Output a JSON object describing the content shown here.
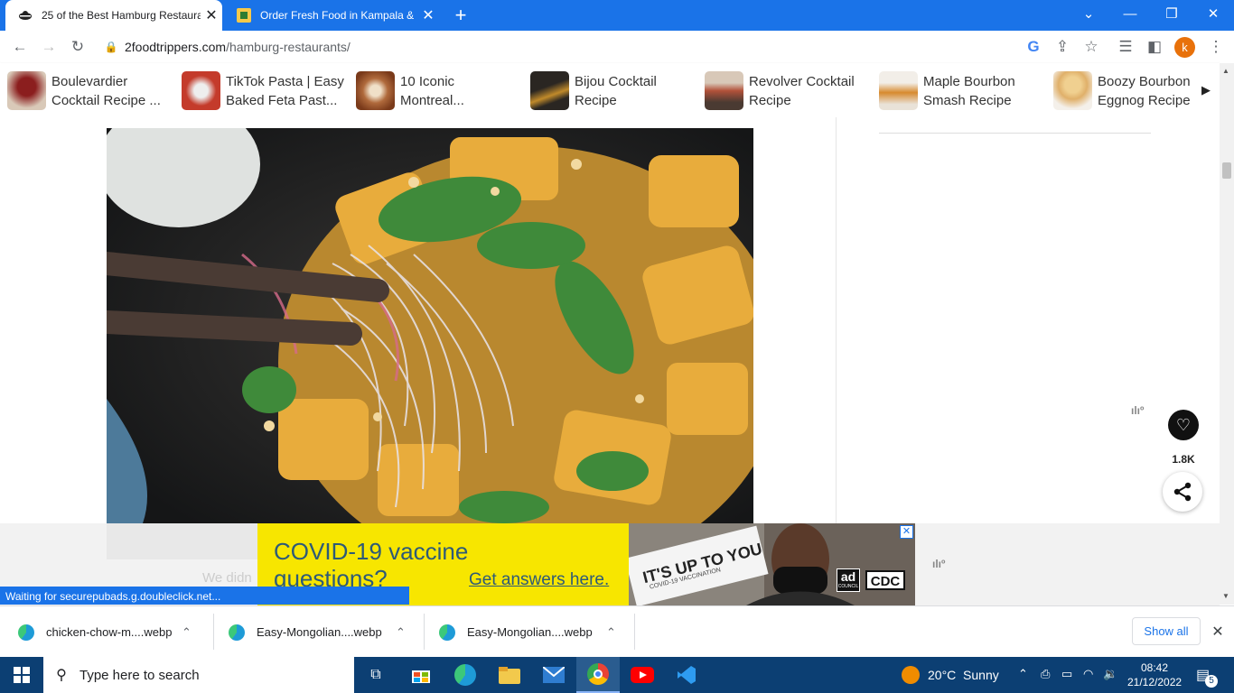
{
  "browser": {
    "tabs": [
      {
        "title": "25 of the Best Hamburg Restaura",
        "active": true
      },
      {
        "title": "Order Fresh Food in Kampala & E",
        "active": false
      }
    ],
    "new_tab_label": "+",
    "url_host": "2foodtrippers.com",
    "url_path": "/hamburg-restaurants/",
    "profile_initial": "k"
  },
  "recipes": [
    {
      "label": "Boulevardier\nCocktail Recipe ...",
      "color": "#b64a3a"
    },
    {
      "label": "TikTok Pasta | Easy\nBaked Feta Past...",
      "color": "#c43b2b"
    },
    {
      "label": "10 Iconic\nMontreal...",
      "color": "#b06a3c"
    },
    {
      "label": "Bijou Cocktail\nRecipe",
      "color": "#4a4038"
    },
    {
      "label": "Revolver Cocktail\nRecipe",
      "color": "#8e5a44"
    },
    {
      "label": "Maple Bourbon\nSmash Recipe",
      "color": "#d78a2e"
    },
    {
      "label": "Boozy Bourbon\nEggnog Recipe ...",
      "color": "#e0b06a"
    }
  ],
  "social": {
    "like_count": "1.8K"
  },
  "ad": {
    "headline": "COVID-19 vaccine questions?",
    "cta": "Get answers here.",
    "photo_text": "IT'S UP TO YOU",
    "photo_subtext": "COVID-19 VACCINATION",
    "badge_ad": "ad",
    "badge_ad_sub": "COUNCIL",
    "badge_cdc": "CDC",
    "faded_text": "We didn"
  },
  "status_text": "Waiting for securepubads.g.doubleclick.net...",
  "downloads": {
    "items": [
      "chicken-chow-m....webp",
      "Easy-Mongolian....webp",
      "Easy-Mongolian....webp"
    ],
    "show_all": "Show all"
  },
  "taskbar": {
    "search_placeholder": "Type here to search",
    "weather": "20°C  Sunny",
    "time": "08:42",
    "date": "21/12/2022",
    "notification_count": "5"
  },
  "colors": {
    "accent": "#1a73e8",
    "taskbar": "#0c3f73",
    "ad_yellow": "#f7e600"
  }
}
